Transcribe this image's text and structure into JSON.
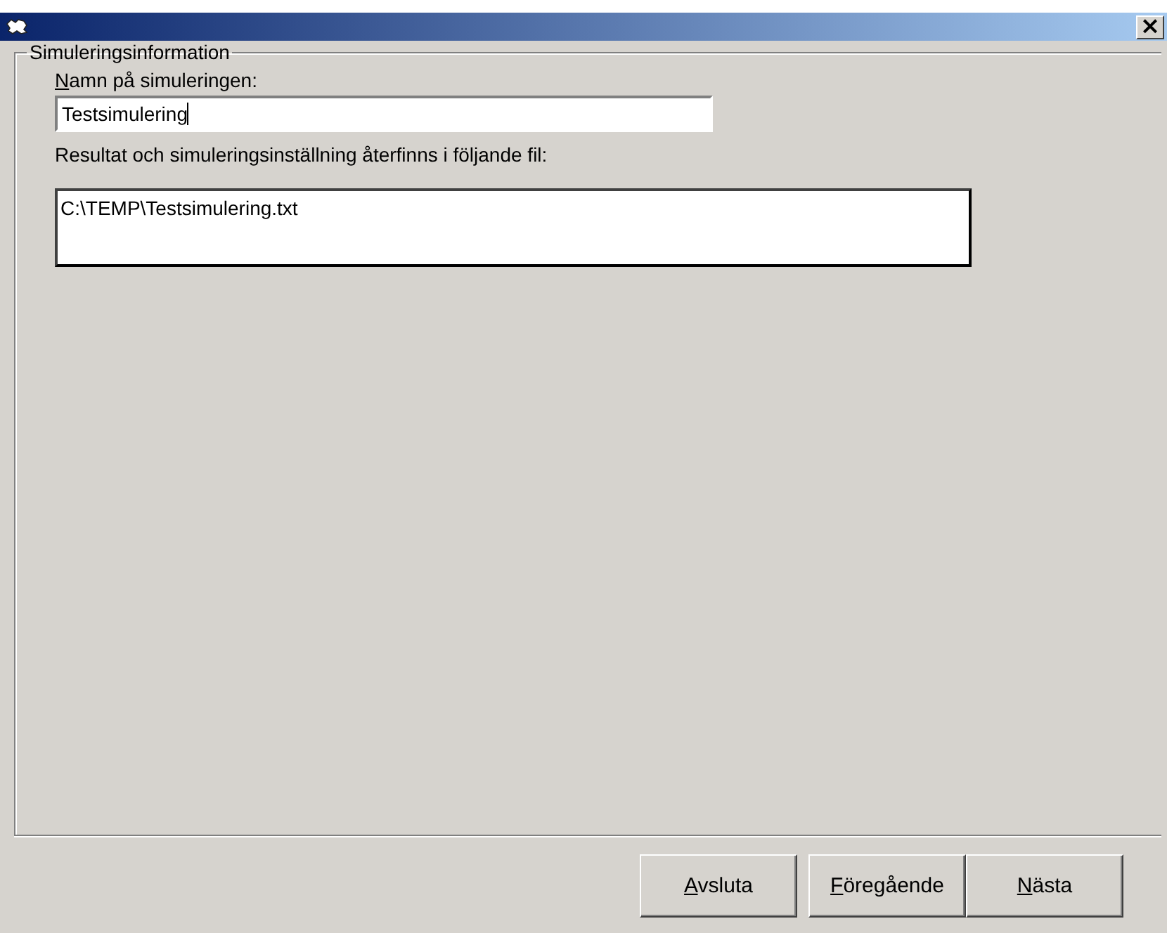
{
  "window": {
    "close": "×"
  },
  "group": {
    "title": "Simuleringsinformation"
  },
  "name_field": {
    "label": "Namn på simuleringen:",
    "underlined": true,
    "value": "Testsimulering",
    "focused": true
  },
  "file_label": "Resultat och simuleringsinställning återfinns i följande fil:",
  "file_box": {
    "value": "C:\\TEMP\\Testsimulering.txt"
  },
  "buttons": [
    {
      "label": "Avsluta",
      "underlined": true
    },
    {
      "label": "Föregående",
      "underlined": true
    },
    {
      "label": "Nästa",
      "underlined": true
    }
  ]
}
